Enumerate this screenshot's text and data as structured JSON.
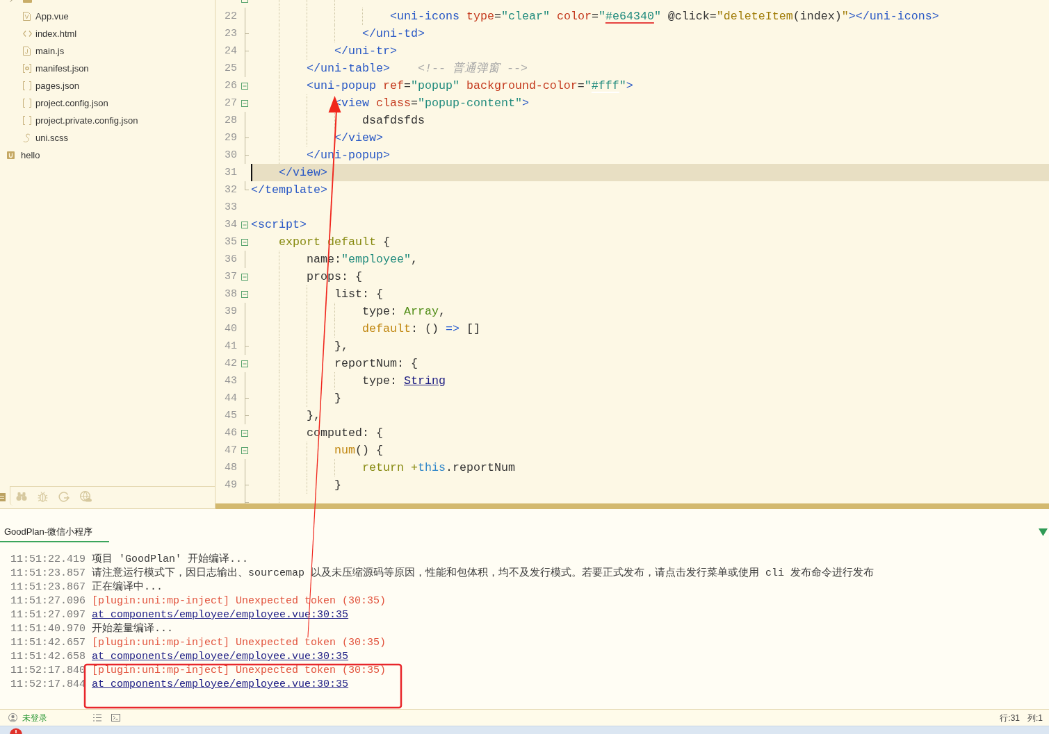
{
  "sidebar": {
    "files": [
      {
        "kind": "folder",
        "expanded": false
      },
      {
        "name": "App.vue",
        "kind": "vue"
      },
      {
        "name": "index.html",
        "kind": "html"
      },
      {
        "name": "main.js",
        "kind": "js"
      },
      {
        "name": "manifest.json",
        "kind": "manifest"
      },
      {
        "name": "pages.json",
        "kind": "json"
      },
      {
        "name": "project.config.json",
        "kind": "json"
      },
      {
        "name": "project.private.config.json",
        "kind": "json"
      },
      {
        "name": "uni.scss",
        "kind": "scss"
      }
    ],
    "projects": [
      {
        "name": "hello"
      }
    ]
  },
  "editor": {
    "lines": [
      {
        "children": [
          {
            "children": [
              {
                "children": [
                  {
                    "children": [
                      {
                        "kind": "start",
                        "current": false,
                        "children": [
                          {
                            "number": "22",
                            "kind": "inside",
                            "current": false,
                            "tokens": [
                              {
                                "text": "<uni-icons",
                                "kind": "tag"
                              },
                              {
                                "text": " type",
                                "kind": "attr"
                              },
                              {
                                "text": "=",
                                "kind": "plain"
                              },
                              {
                                "text": "\"clear\"",
                                "kind": "str"
                              },
                              {
                                "text": " color",
                                "kind": "attr"
                              },
                              {
                                "text": "=",
                                "kind": "plain"
                              },
                              {
                                "text": "\"",
                                "kind": "str"
                              },
                              {
                                "text": "#e64340",
                                "kind": "color_value",
                                "color": "#e64340"
                              },
                              {
                                "text": "\"",
                                "kind": "str"
                              },
                              {
                                "text": " @click=",
                                "kind": "plain"
                              },
                              {
                                "text": "\"deleteItem",
                                "kind": "func"
                              },
                              {
                                "text": "(index)",
                                "kind": "plain"
                              },
                              {
                                "text": "\"",
                                "kind": "func"
                              },
                              {
                                "text": "></uni-icons>",
                                "kind": "tag"
                              }
                            ]
                          }
                        ]
                      },
                      {
                        "number": "23",
                        "kind": "end",
                        "current": false,
                        "tokens": [
                          {
                            "text": "</uni-td>",
                            "kind": "tag"
                          }
                        ]
                      }
                    ]
                  },
                  {
                    "number": "24",
                    "kind": "end",
                    "current": false,
                    "tokens": [
                      {
                        "text": "</uni-tr>",
                        "kind": "tag"
                      }
                    ]
                  }
                ]
              },
              {
                "number": "25",
                "kind": "inside",
                "current": false,
                "tokens": [
                  {
                    "text": "</uni-table>",
                    "kind": "tag"
                  },
                  {
                    "text": "    <!-- 普通弹窗 -->",
                    "kind": "comment"
                  }
                ]
              },
              {
                "number": "26",
                "kind": "start",
                "current": false,
                "tokens": [
                  {
                    "text": "<uni-popup",
                    "kind": "tag"
                  },
                  {
                    "text": " ref",
                    "kind": "attr"
                  },
                  {
                    "text": "=",
                    "kind": "plain"
                  },
                  {
                    "text": "\"popup\"",
                    "kind": "str"
                  },
                  {
                    "text": " background-color",
                    "kind": "attr"
                  },
                  {
                    "text": "=",
                    "kind": "plain"
                  },
                  {
                    "text": "\"",
                    "kind": "str"
                  },
                  {
                    "text": "#fff",
                    "kind": "color_value",
                    "color": "#ffffff"
                  },
                  {
                    "text": "\"",
                    "kind": "str"
                  },
                  {
                    "text": ">",
                    "kind": "tag"
                  }
                ],
                "children": [
                  {
                    "number": "27",
                    "kind": "start",
                    "current": false,
                    "tokens": [
                      {
                        "text": "<view",
                        "kind": "tag"
                      },
                      {
                        "text": " class",
                        "kind": "attr"
                      },
                      {
                        "text": "=",
                        "kind": "plain"
                      },
                      {
                        "text": "\"popup-content\"",
                        "kind": "str"
                      },
                      {
                        "text": ">",
                        "kind": "tag"
                      }
                    ],
                    "children": [
                      {
                        "number": "28",
                        "kind": "inside",
                        "current": false,
                        "tokens": [
                          {
                            "text": "dsafdsfds",
                            "kind": "plain"
                          }
                        ]
                      }
                    ]
                  },
                  {
                    "number": "29",
                    "kind": "end",
                    "current": false,
                    "tokens": [
                      {
                        "text": "</view>",
                        "kind": "tag"
                      }
                    ]
                  }
                ]
              },
              {
                "number": "30",
                "kind": "end",
                "current": false,
                "tokens": [
                  {
                    "text": "</uni-popup>",
                    "kind": "tag"
                  }
                ]
              }
            ]
          },
          {
            "number": "31",
            "kind": "none",
            "current": true,
            "tokens": [
              {
                "text": "</view>",
                "kind": "tag"
              }
            ]
          }
        ]
      },
      {
        "number": "32",
        "kind": "corner",
        "current": false,
        "tokens": [
          {
            "text": "</template>",
            "kind": "tag"
          }
        ]
      },
      {
        "number": "33",
        "kind": "none",
        "current": false
      },
      {
        "number": "34",
        "kind": "start",
        "current": false,
        "tokens": [
          {
            "text": "<script>",
            "kind": "tag"
          }
        ],
        "children": [
          {
            "number": "35",
            "kind": "start",
            "current": false,
            "tokens": [
              {
                "text": "export default",
                "kind": "keyword"
              },
              {
                "text": " {",
                "kind": "plain"
              }
            ],
            "children": [
              {
                "number": "36",
                "kind": "inside",
                "current": false,
                "tokens": [
                  {
                    "text": "name:",
                    "kind": "plain"
                  },
                  {
                    "text": "\"employee\"",
                    "kind": "str"
                  },
                  {
                    "text": ",",
                    "kind": "plain"
                  }
                ]
              },
              {
                "number": "37",
                "kind": "start",
                "current": false,
                "tokens": [
                  {
                    "text": "props: {",
                    "kind": "plain"
                  }
                ],
                "children": [
                  {
                    "number": "38",
                    "kind": "start",
                    "current": false,
                    "tokens": [
                      {
                        "text": "list: {",
                        "kind": "plain"
                      }
                    ],
                    "children": [
                      {
                        "number": "39",
                        "kind": "inside",
                        "current": false,
                        "tokens": [
                          {
                            "text": "type: ",
                            "kind": "plain"
                          },
                          {
                            "text": "Array",
                            "kind": "builtin"
                          },
                          {
                            "text": ",",
                            "kind": "plain"
                          }
                        ]
                      },
                      {
                        "number": "40",
                        "kind": "inside",
                        "current": false,
                        "tokens": [
                          {
                            "text": "default",
                            "kind": "member"
                          },
                          {
                            "text": ": () ",
                            "kind": "plain"
                          },
                          {
                            "text": "=>",
                            "kind": "operator"
                          },
                          {
                            "text": " []",
                            "kind": "plain"
                          }
                        ]
                      }
                    ]
                  },
                  {
                    "number": "41",
                    "kind": "end",
                    "current": false,
                    "tokens": [
                      {
                        "text": "},",
                        "kind": "plain"
                      }
                    ]
                  },
                  {
                    "number": "42",
                    "kind": "start",
                    "current": false,
                    "tokens": [
                      {
                        "text": "reportNum: {",
                        "kind": "plain"
                      }
                    ],
                    "children": [
                      {
                        "number": "43",
                        "kind": "inside",
                        "current": false,
                        "tokens": [
                          {
                            "text": "type: ",
                            "kind": "plain"
                          },
                          {
                            "text": "String",
                            "kind": "link"
                          }
                        ]
                      }
                    ]
                  },
                  {
                    "number": "44",
                    "kind": "end",
                    "current": false,
                    "tokens": [
                      {
                        "text": "}",
                        "kind": "plain"
                      }
                    ]
                  }
                ]
              },
              {
                "number": "45",
                "kind": "end",
                "current": false,
                "tokens": [
                  {
                    "text": "},",
                    "kind": "plain"
                  }
                ]
              },
              {
                "number": "46",
                "kind": "start",
                "current": false,
                "tokens": [
                  {
                    "text": "computed: {",
                    "kind": "plain"
                  }
                ],
                "children": [
                  {
                    "number": "47",
                    "kind": "start",
                    "current": false,
                    "tokens": [
                      {
                        "text": "num",
                        "kind": "member"
                      },
                      {
                        "text": "() {",
                        "kind": "plain"
                      }
                    ],
                    "children": [
                      {
                        "number": "48",
                        "kind": "inside",
                        "current": false,
                        "tokens": [
                          {
                            "text": "return",
                            "kind": "keyword"
                          },
                          {
                            "text": " +",
                            "kind": "keyword"
                          },
                          {
                            "text": "this",
                            "kind": "self"
                          },
                          {
                            "text": ".reportNum",
                            "kind": "plain"
                          }
                        ]
                      }
                    ]
                  },
                  {
                    "number": "49",
                    "kind": "end",
                    "current": false,
                    "tokens": [
                      {
                        "text": "}",
                        "kind": "plain"
                      }
                    ]
                  }
                ]
              },
              {
                "kind": "end",
                "current": false
              }
            ]
          }
        ]
      }
    ]
  },
  "console": {
    "tabs": [
      {
        "label": "GoodPlan-微信小程序",
        "selected": true
      }
    ],
    "logs": [
      {
        "time": "11:51:22.419",
        "kind": "info",
        "text": "项目 'GoodPlan' 开始编译..."
      },
      {
        "time": "11:51:23.857",
        "kind": "info",
        "text": "请注意运行模式下，因日志输出、sourcemap 以及未压缩源码等原因，性能和包体积，均不及发行模式。若要正式发布，请点击发行菜单或使用 cli 发布命令进行发布"
      },
      {
        "time": "11:51:23.867",
        "kind": "info",
        "text": "正在编译中..."
      },
      {
        "time": "11:51:27.096",
        "kind": "error",
        "text": "[plugin:uni:mp-inject] Unexpected token (30:35)"
      },
      {
        "time": "11:51:27.097",
        "kind": "link",
        "text": "at components/employee/employee.vue:30:35"
      },
      {
        "time": "11:51:40.970",
        "kind": "info",
        "text": "开始差量编译..."
      },
      {
        "time": "11:51:42.657",
        "kind": "error",
        "text": "[plugin:uni:mp-inject] Unexpected token (30:35)"
      },
      {
        "time": "11:51:42.658",
        "kind": "link",
        "text": "at components/employee/employee.vue:30:35"
      },
      {
        "time": "11:52:17.840",
        "kind": "error",
        "text": "[plugin:uni:mp-inject] Unexpected token (30:35)"
      },
      {
        "time": "11:52:17.844",
        "kind": "link",
        "text": "at components/employee/employee.vue:30:35"
      }
    ]
  },
  "status_bar": {
    "login": "未登录",
    "line": "行:31",
    "column": "列:1"
  }
}
